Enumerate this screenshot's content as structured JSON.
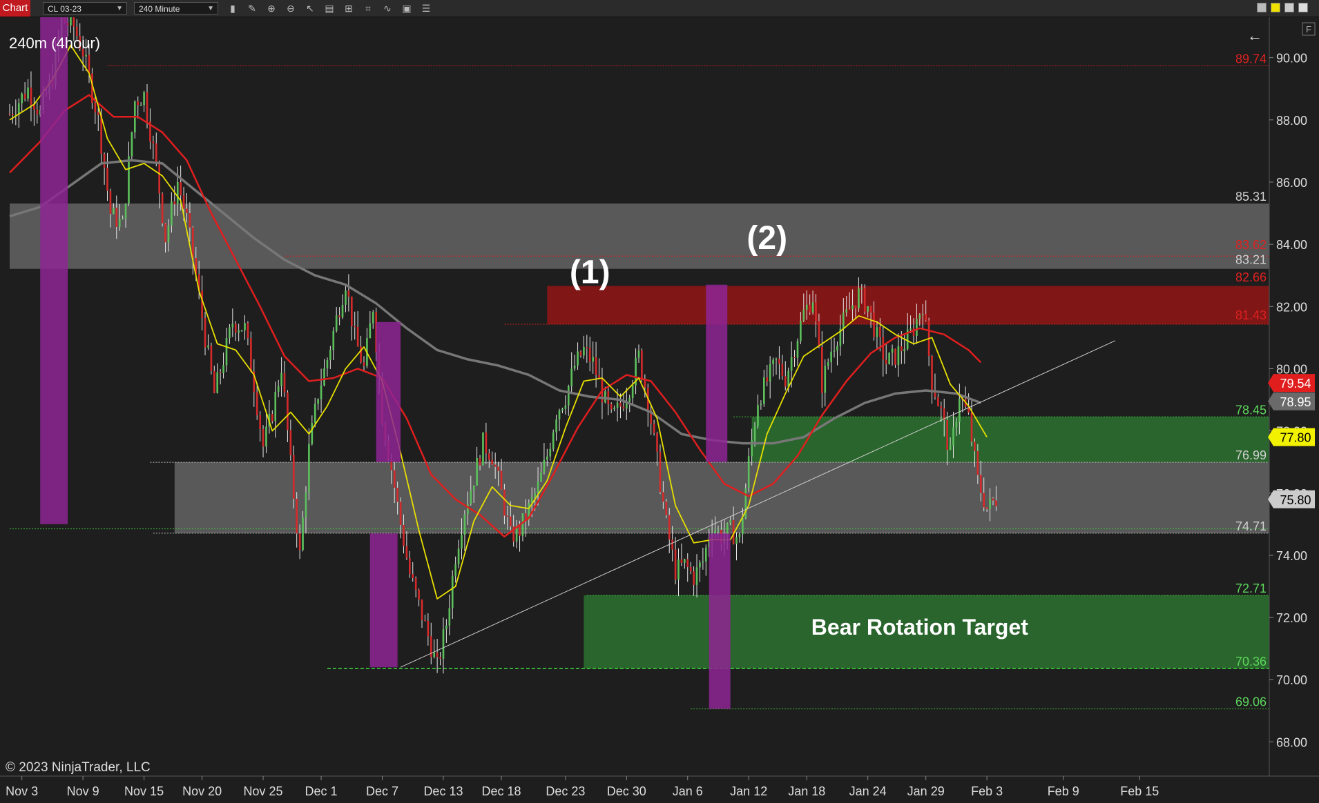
{
  "toolbar": {
    "tab_label": "Chart",
    "instrument": "CL 03-23",
    "interval": "240 Minute",
    "icons": [
      "bar-type-icon",
      "pencil-icon",
      "zoom-in-icon",
      "zoom-out-icon",
      "pointer-icon",
      "properties-icon",
      "strategy-icon",
      "indicator-icon",
      "template-icon",
      "data-box-icon",
      "list-icon"
    ]
  },
  "colors": {
    "background": "#1e1e1e",
    "up_candle": "#5cbf5c",
    "down_candle": "#d42a2a",
    "ema_fast": "#e8e000",
    "ema_mid": "#e01e1e",
    "sma_slow": "#777777",
    "resistance_zone": "#8b1515",
    "support_zone": "#2e7d32",
    "grey_zone": "#8a8a8a",
    "magenta_bar": "#8e2494"
  },
  "chart_data": {
    "type": "candlestick",
    "timeframe_label": "240m (4hour)",
    "copyright": "© 2023 NinjaTrader, LLC",
    "back_arrow": "←",
    "ylim": [
      66.9,
      91.3
    ],
    "y_ticks": [
      "68.00",
      "70.00",
      "72.00",
      "74.00",
      "76.00",
      "78.00",
      "80.00",
      "82.00",
      "84.00",
      "86.00",
      "88.00",
      "90.00"
    ],
    "x_ticks": [
      {
        "label": "Nov 3",
        "bar": 4
      },
      {
        "label": "Nov 9",
        "bar": 24
      },
      {
        "label": "Nov 15",
        "bar": 44
      },
      {
        "label": "Nov 20",
        "bar": 63
      },
      {
        "label": "Nov 25",
        "bar": 83
      },
      {
        "label": "Dec 1",
        "bar": 102
      },
      {
        "label": "Dec 7",
        "bar": 122
      },
      {
        "label": "Dec 13",
        "bar": 142
      },
      {
        "label": "Dec 18",
        "bar": 161
      },
      {
        "label": "Dec 23",
        "bar": 182
      },
      {
        "label": "Dec 30",
        "bar": 202
      },
      {
        "label": "Jan 6",
        "bar": 222
      },
      {
        "label": "Jan 12",
        "bar": 242
      },
      {
        "label": "Jan 18",
        "bar": 261
      },
      {
        "label": "Jan 24",
        "bar": 281
      },
      {
        "label": "Jan 29",
        "bar": 300
      },
      {
        "label": "Feb 3",
        "bar": 320
      },
      {
        "label": "Feb 9",
        "bar": 345
      },
      {
        "label": "Feb 15",
        "bar": 370
      }
    ],
    "bar_count_axis": 412,
    "last_bar": 323,
    "anchors": [
      [
        0,
        88.2
      ],
      [
        6,
        89.0
      ],
      [
        10,
        88.2
      ],
      [
        14,
        89.4
      ],
      [
        17,
        91.2
      ],
      [
        21,
        91.0
      ],
      [
        24,
        90.2
      ],
      [
        29,
        88.0
      ],
      [
        33,
        85.0
      ],
      [
        37,
        84.6
      ],
      [
        41,
        88.6
      ],
      [
        44,
        88.8
      ],
      [
        48,
        86.5
      ],
      [
        51,
        84.2
      ],
      [
        55,
        86.0
      ],
      [
        58,
        84.8
      ],
      [
        61,
        83.0
      ],
      [
        64,
        81.0
      ],
      [
        67,
        79.2
      ],
      [
        70,
        80.3
      ],
      [
        73,
        81.5
      ],
      [
        77,
        81.3
      ],
      [
        80,
        79.5
      ],
      [
        83,
        77.5
      ],
      [
        86,
        78.6
      ],
      [
        89,
        80.1
      ],
      [
        92,
        76.9
      ],
      [
        95,
        74.0
      ],
      [
        98,
        77.4
      ],
      [
        101,
        79.2
      ],
      [
        104,
        80.3
      ],
      [
        107,
        81.6
      ],
      [
        110,
        82.8
      ],
      [
        113,
        81.0
      ],
      [
        116,
        80.0
      ],
      [
        119,
        82.0
      ],
      [
        122,
        78.5
      ],
      [
        125,
        76.8
      ],
      [
        128,
        75.0
      ],
      [
        131,
        73.4
      ],
      [
        134,
        72.4
      ],
      [
        137,
        71.4
      ],
      [
        140,
        70.4
      ],
      [
        143,
        71.8
      ],
      [
        146,
        74.0
      ],
      [
        149,
        75.5
      ],
      [
        152,
        76.5
      ],
      [
        155,
        77.6
      ],
      [
        158,
        77.2
      ],
      [
        161,
        76.0
      ],
      [
        164,
        74.6
      ],
      [
        167,
        74.8
      ],
      [
        170,
        75.5
      ],
      [
        173,
        76.2
      ],
      [
        176,
        77.2
      ],
      [
        179,
        78.6
      ],
      [
        182,
        79.1
      ],
      [
        185,
        80.1
      ],
      [
        188,
        80.6
      ],
      [
        191,
        80.2
      ],
      [
        194,
        79.2
      ],
      [
        197,
        78.4
      ],
      [
        200,
        78.8
      ],
      [
        203,
        79.4
      ],
      [
        206,
        80.4
      ],
      [
        209,
        79.0
      ],
      [
        212,
        77.0
      ],
      [
        215,
        75.0
      ],
      [
        218,
        73.5
      ],
      [
        221,
        73.7
      ],
      [
        224,
        73.3
      ],
      [
        227,
        73.8
      ],
      [
        230,
        75.0
      ],
      [
        233,
        74.6
      ],
      [
        236,
        74.8
      ],
      [
        239,
        74.5
      ],
      [
        242,
        77.0
      ],
      [
        245,
        79.0
      ],
      [
        248,
        79.6
      ],
      [
        251,
        80.2
      ],
      [
        254,
        79.7
      ],
      [
        257,
        80.7
      ],
      [
        260,
        81.8
      ],
      [
        263,
        82.3
      ],
      [
        266,
        79.5
      ],
      [
        269,
        80.6
      ],
      [
        272,
        81.3
      ],
      [
        275,
        81.9
      ],
      [
        278,
        82.4
      ],
      [
        281,
        82.0
      ],
      [
        284,
        81.0
      ],
      [
        287,
        80.2
      ],
      [
        290,
        80.4
      ],
      [
        293,
        80.8
      ],
      [
        296,
        81.3
      ],
      [
        299,
        82.1
      ],
      [
        302,
        79.6
      ],
      [
        305,
        78.6
      ],
      [
        308,
        77.2
      ],
      [
        311,
        79.2
      ],
      [
        314,
        78.4
      ],
      [
        317,
        76.4
      ],
      [
        320,
        75.5
      ],
      [
        323,
        75.8
      ]
    ],
    "ema_fast": [
      [
        0,
        88.0
      ],
      [
        8,
        88.5
      ],
      [
        14,
        89.3
      ],
      [
        20,
        90.4
      ],
      [
        26,
        89.5
      ],
      [
        32,
        87.4
      ],
      [
        38,
        86.4
      ],
      [
        44,
        86.6
      ],
      [
        50,
        86.2
      ],
      [
        56,
        85.4
      ],
      [
        62,
        82.5
      ],
      [
        68,
        80.8
      ],
      [
        74,
        80.6
      ],
      [
        80,
        79.8
      ],
      [
        86,
        78.0
      ],
      [
        92,
        78.6
      ],
      [
        98,
        77.9
      ],
      [
        104,
        78.8
      ],
      [
        110,
        80.0
      ],
      [
        116,
        80.7
      ],
      [
        122,
        79.6
      ],
      [
        128,
        77.3
      ],
      [
        134,
        74.8
      ],
      [
        140,
        72.6
      ],
      [
        146,
        73.0
      ],
      [
        152,
        75.1
      ],
      [
        158,
        76.2
      ],
      [
        164,
        75.6
      ],
      [
        170,
        75.5
      ],
      [
        176,
        76.4
      ],
      [
        182,
        78.1
      ],
      [
        188,
        79.6
      ],
      [
        194,
        79.7
      ],
      [
        200,
        79.1
      ],
      [
        206,
        79.7
      ],
      [
        212,
        78.4
      ],
      [
        218,
        75.6
      ],
      [
        224,
        74.4
      ],
      [
        230,
        74.5
      ],
      [
        236,
        74.5
      ],
      [
        242,
        75.6
      ],
      [
        248,
        77.9
      ],
      [
        254,
        79.2
      ],
      [
        260,
        80.4
      ],
      [
        266,
        80.8
      ],
      [
        272,
        81.2
      ],
      [
        278,
        81.7
      ],
      [
        284,
        81.5
      ],
      [
        290,
        81.1
      ],
      [
        296,
        80.8
      ],
      [
        302,
        81.0
      ],
      [
        308,
        79.5
      ],
      [
        314,
        78.8
      ],
      [
        320,
        77.8
      ]
    ],
    "ema_mid": [
      [
        0,
        86.3
      ],
      [
        10,
        87.3
      ],
      [
        18,
        88.3
      ],
      [
        26,
        88.8
      ],
      [
        34,
        88.1
      ],
      [
        42,
        88.1
      ],
      [
        50,
        87.6
      ],
      [
        58,
        86.7
      ],
      [
        66,
        85.0
      ],
      [
        74,
        83.5
      ],
      [
        82,
        82.0
      ],
      [
        90,
        80.4
      ],
      [
        98,
        79.6
      ],
      [
        106,
        79.7
      ],
      [
        114,
        80.0
      ],
      [
        122,
        79.7
      ],
      [
        130,
        78.4
      ],
      [
        138,
        76.6
      ],
      [
        146,
        75.8
      ],
      [
        154,
        75.3
      ],
      [
        162,
        74.6
      ],
      [
        170,
        75.2
      ],
      [
        178,
        76.6
      ],
      [
        186,
        78.1
      ],
      [
        194,
        79.3
      ],
      [
        202,
        79.8
      ],
      [
        210,
        79.6
      ],
      [
        218,
        78.6
      ],
      [
        226,
        77.4
      ],
      [
        234,
        76.3
      ],
      [
        242,
        75.9
      ],
      [
        250,
        76.3
      ],
      [
        258,
        77.2
      ],
      [
        266,
        78.5
      ],
      [
        274,
        79.6
      ],
      [
        282,
        80.5
      ],
      [
        290,
        81.0
      ],
      [
        298,
        81.3
      ],
      [
        306,
        81.1
      ],
      [
        314,
        80.6
      ],
      [
        318,
        80.2
      ]
    ],
    "sma_slow": [
      [
        0,
        84.9
      ],
      [
        10,
        85.2
      ],
      [
        20,
        85.9
      ],
      [
        30,
        86.6
      ],
      [
        40,
        86.7
      ],
      [
        50,
        86.6
      ],
      [
        60,
        85.8
      ],
      [
        70,
        85.0
      ],
      [
        80,
        84.2
      ],
      [
        90,
        83.5
      ],
      [
        100,
        83.0
      ],
      [
        110,
        82.7
      ],
      [
        120,
        82.1
      ],
      [
        130,
        81.3
      ],
      [
        140,
        80.6
      ],
      [
        150,
        80.3
      ],
      [
        160,
        80.1
      ],
      [
        170,
        79.8
      ],
      [
        180,
        79.3
      ],
      [
        190,
        79.1
      ],
      [
        200,
        79.0
      ],
      [
        210,
        78.6
      ],
      [
        220,
        77.9
      ],
      [
        230,
        77.7
      ],
      [
        240,
        77.6
      ],
      [
        250,
        77.6
      ],
      [
        260,
        77.8
      ],
      [
        270,
        78.4
      ],
      [
        280,
        78.9
      ],
      [
        290,
        79.2
      ],
      [
        300,
        79.3
      ],
      [
        310,
        79.2
      ],
      [
        318,
        78.9
      ]
    ],
    "zones": [
      {
        "name": "upper-grey-zone",
        "kind": "grey",
        "y1": 83.21,
        "y2": 85.31,
        "x1": 0
      },
      {
        "name": "middle-grey-zone",
        "kind": "grey",
        "y1": 74.71,
        "y2": 76.99,
        "x1": 54
      },
      {
        "name": "resistance-zone",
        "kind": "red",
        "y1": 81.43,
        "y2": 82.66,
        "x1": 176
      },
      {
        "name": "upper-green-zone",
        "kind": "green",
        "y1": 76.99,
        "y2": 78.45,
        "x1": 243
      },
      {
        "name": "bear-target-zone",
        "kind": "green",
        "y1": 70.36,
        "y2": 72.71,
        "x1": 188
      }
    ],
    "magenta_bars": [
      {
        "x1": 10,
        "x2": 19,
        "y1": 75.0,
        "y2": 91.3
      },
      {
        "x1": 120,
        "x2": 128,
        "y1": 77.0,
        "y2": 81.5
      },
      {
        "x1": 118,
        "x2": 127,
        "y1": 70.4,
        "y2": 74.7
      },
      {
        "x1": 228,
        "x2": 235,
        "y1": 77.0,
        "y2": 82.7
      },
      {
        "x1": 229,
        "x2": 236,
        "y1": 69.06,
        "y2": 74.7
      }
    ],
    "level_lines": [
      {
        "y": 89.74,
        "x1": 32,
        "style": "red-dotted"
      },
      {
        "y": 83.62,
        "x1": 90,
        "style": "red-dotted"
      },
      {
        "y": 81.43,
        "x1": 162,
        "style": "red-dotted"
      },
      {
        "y": 74.85,
        "x1": 0,
        "style": "green-dotted"
      },
      {
        "y": 70.36,
        "x1": 104,
        "style": "green-dashed"
      },
      {
        "y": 69.06,
        "x1": 223,
        "style": "green-dotted"
      },
      {
        "y": 78.45,
        "x1": 237,
        "style": "green-dotted"
      },
      {
        "y": 76.99,
        "x1": 46,
        "style": "white-dotted"
      },
      {
        "y": 74.71,
        "x1": 47,
        "style": "white-dotted"
      },
      {
        "y": 72.71,
        "x1": 189,
        "style": "green-dotted"
      }
    ],
    "trendline": {
      "x1": 128,
      "y1": 70.4,
      "x2": 362,
      "y2": 80.9
    },
    "right_labels": [
      {
        "text": "89.74",
        "y": 89.74,
        "color": "#e02020"
      },
      {
        "text": "85.31",
        "y": 85.31,
        "color": "#cfcfcf"
      },
      {
        "text": "83.62",
        "y": 83.76,
        "color": "#e02020"
      },
      {
        "text": "83.21",
        "y": 83.28,
        "color": "#cfcfcf"
      },
      {
        "text": "82.66",
        "y": 82.72,
        "color": "#e02020"
      },
      {
        "text": "81.43",
        "y": 81.5,
        "color": "#e02020"
      },
      {
        "text": "78.45",
        "y": 78.45,
        "color": "#5cd65c"
      },
      {
        "text": "76.99",
        "y": 76.99,
        "color": "#cfcfcf"
      },
      {
        "text": "74.71",
        "y": 74.71,
        "color": "#cfcfcf"
      },
      {
        "text": "72.71",
        "y": 72.71,
        "color": "#5cd65c"
      },
      {
        "text": "70.36",
        "y": 70.36,
        "color": "#5cd65c"
      },
      {
        "text": "69.06",
        "y": 69.06,
        "color": "#5cd65c"
      }
    ],
    "price_badges": [
      {
        "text": "79.54",
        "y": 79.54,
        "bg": "#e01e1e",
        "fg": "#ffffff"
      },
      {
        "text": "78.95",
        "y": 78.95,
        "bg": "#6a6a6a",
        "fg": "#ffffff"
      },
      {
        "text": "77.80",
        "y": 77.8,
        "bg": "#f2f200",
        "fg": "#000000"
      },
      {
        "text": "75.80",
        "y": 75.8,
        "bg": "#cccccc",
        "fg": "#000000"
      }
    ],
    "annotations": [
      {
        "text": "(1)",
        "x": 190,
        "y": 82.75
      },
      {
        "text": "(2)",
        "x": 248,
        "y": 83.85
      },
      {
        "text": "Bear Rotation Target",
        "x": 298,
        "y": 71.45
      }
    ]
  }
}
